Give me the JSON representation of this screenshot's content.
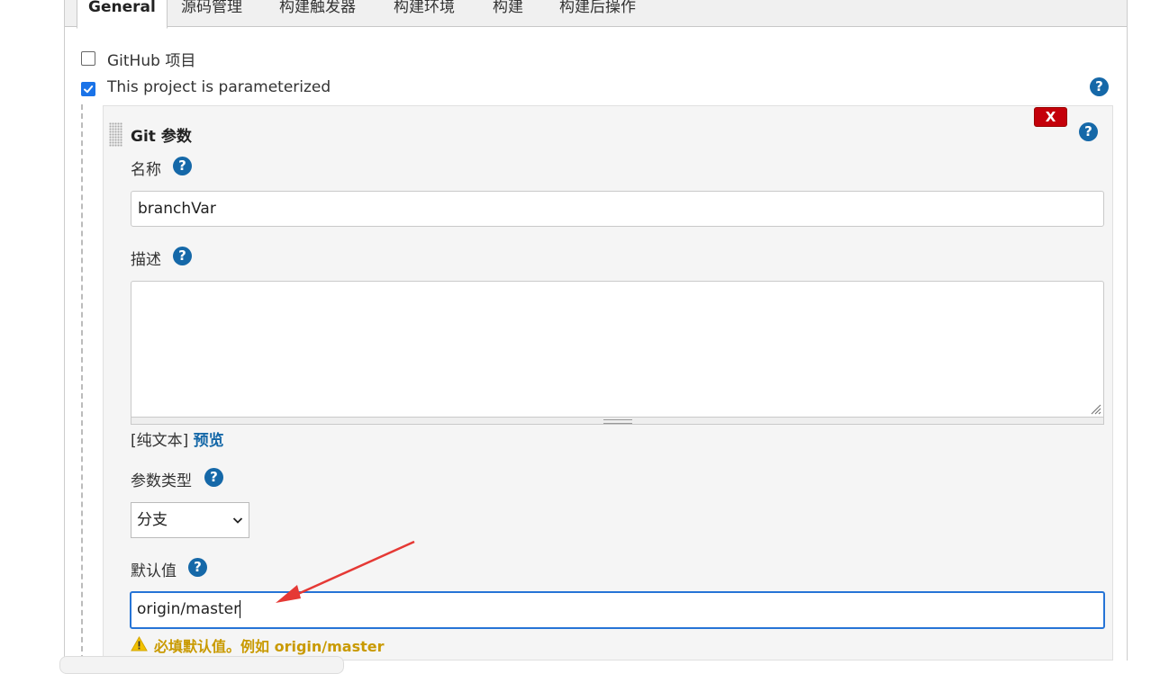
{
  "tabs": [
    {
      "label": "General",
      "active": true
    },
    {
      "label": "源码管理"
    },
    {
      "label": "构建触发器"
    },
    {
      "label": "构建环境"
    },
    {
      "label": "构建"
    },
    {
      "label": "构建后操作"
    }
  ],
  "options": {
    "github_project": {
      "label": "GitHub 项目",
      "checked": false
    },
    "parameterized": {
      "label": "This project is parameterized",
      "checked": true
    }
  },
  "help_glyph": "?",
  "parameter": {
    "title": "Git 参数",
    "close_label": "X",
    "name": {
      "label": "名称",
      "value": "branchVar"
    },
    "description": {
      "label": "描述",
      "value": "",
      "format_prefix": "[纯文本]",
      "preview_link": "预览"
    },
    "param_type": {
      "label": "参数类型",
      "selected": "分支"
    },
    "default_value": {
      "label": "默认值",
      "value": "origin/master",
      "warning": "必填默认值。例如 origin/master"
    }
  },
  "colors": {
    "accent": "#1568a8",
    "checkbox": "#1a73e8",
    "close": "#c4000a",
    "warning": "#c99a00",
    "annotation_arrow": "#e53935"
  }
}
